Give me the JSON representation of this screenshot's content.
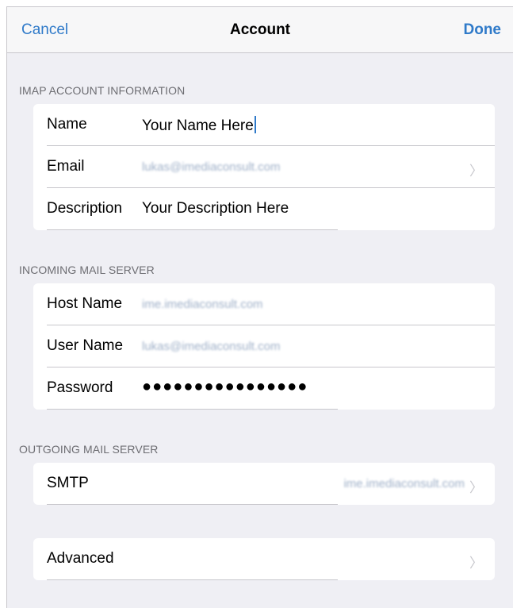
{
  "navbar": {
    "cancel_label": "Cancel",
    "title": "Account",
    "done_label": "Done"
  },
  "imap_section": {
    "header": "IMAP ACCOUNT INFORMATION",
    "rows": [
      {
        "label": "Name",
        "value": "Your Name Here"
      },
      {
        "label": "Email",
        "value": "lukas@imediaconsult.com"
      },
      {
        "label": "Description",
        "value": "Your Description Here"
      }
    ]
  },
  "incoming_section": {
    "header": "INCOMING MAIL SERVER",
    "rows": [
      {
        "label": "Host Name",
        "value": "ime.imediaconsult.com"
      },
      {
        "label": "User Name",
        "value": "lukas@imediaconsult.com"
      },
      {
        "label": "Password",
        "value": "●●●●●●●●●●●●●●●●"
      }
    ]
  },
  "outgoing_section": {
    "header": "OUTGOING MAIL SERVER",
    "rows": [
      {
        "label": "SMTP",
        "value": "ime.imediaconsult.com"
      }
    ]
  },
  "advanced": {
    "label": "Advanced"
  },
  "icons": {
    "chevron": "chevron-right-icon"
  },
  "colors": {
    "accent": "#2f7ac9",
    "background": "#efeff4",
    "header_text": "#6d6d72",
    "chevron": "#c7c7cc"
  }
}
